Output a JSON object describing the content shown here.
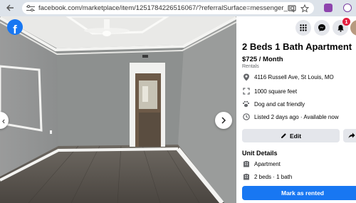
{
  "browser": {
    "url": "facebook.com/marketplace/item/1251784226516067/?referralSurface=messenger_lightspeed_banner&ref..."
  },
  "header": {
    "notification_count": "1"
  },
  "listing": {
    "title": "2 Beds 1 Bath Apartment",
    "price": "$725 / Month",
    "category": "Rentals",
    "details": [
      {
        "icon": "location-pin-icon",
        "text": "4116 Russell Ave, St Louis, MO"
      },
      {
        "icon": "area-icon",
        "text": "1000 square feet"
      },
      {
        "icon": "paw-icon",
        "text": "Dog and cat friendly"
      },
      {
        "icon": "clock-icon",
        "text": "Listed 2 days ago · Available now"
      }
    ]
  },
  "actions": {
    "edit_label": "Edit",
    "mark_rented_label": "Mark as rented"
  },
  "unit_details": {
    "heading": "Unit Details",
    "items": [
      {
        "icon": "building-icon",
        "text": "Apartment"
      },
      {
        "icon": "building-icon",
        "text": "2 beds · 1 bath"
      }
    ]
  },
  "colors": {
    "brand": "#1877f2",
    "button_gray": "#e4e6eb",
    "badge": "#e41e3f"
  }
}
